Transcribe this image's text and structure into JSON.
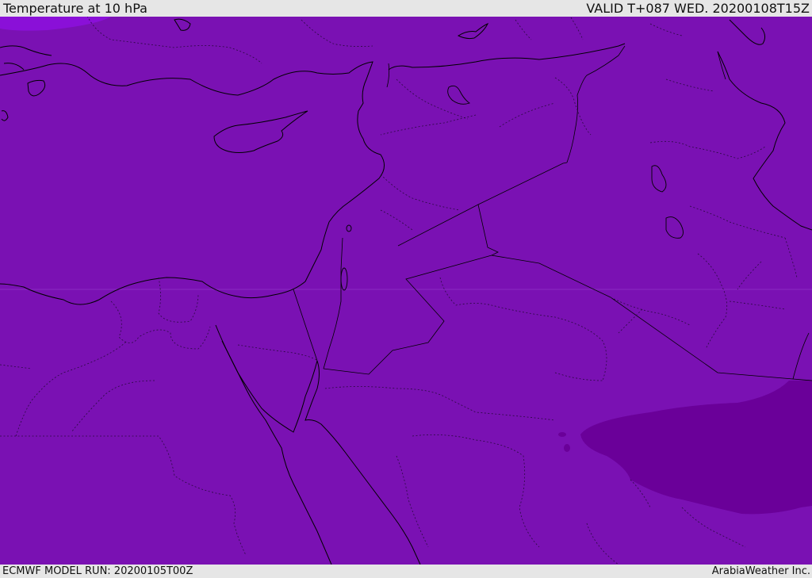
{
  "header": {
    "title": "Temperature at 10 hPa",
    "valid_time": "VALID T+087 WED. 20200108T15Z"
  },
  "footer": {
    "model_run": "ECMWF MODEL RUN: 20200105T00Z",
    "credit": "ArabiaWeather Inc."
  },
  "map": {
    "field_color_main": "#7a11b3",
    "field_color_cold": "#6a0099",
    "field_color_warm_corner": "#8a10d8"
  }
}
